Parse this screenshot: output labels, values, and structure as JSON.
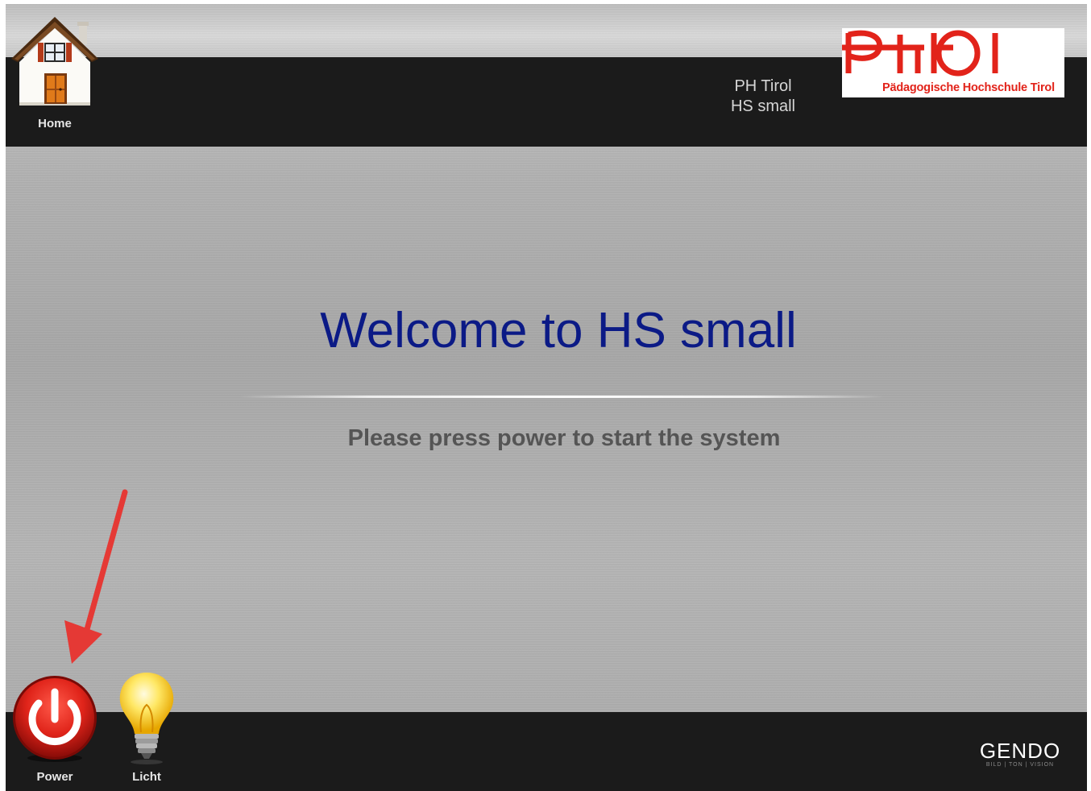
{
  "nav": {
    "home_label": "Home",
    "home_icon": "home-icon"
  },
  "room": {
    "line1": "PH Tirol",
    "line2": "HS small"
  },
  "logo": {
    "subtitle": "Pädagogische Hochschule Tirol",
    "color": "#e2231a"
  },
  "main": {
    "title": "Welcome to HS small",
    "instruction": "Please press power to start the system",
    "title_color": "#0b1a86"
  },
  "footer": {
    "power_label": "Power",
    "licht_label": "Licht",
    "power_icon": "power-icon",
    "licht_icon": "light-bulb-icon",
    "brand": "GENDO",
    "brand_tagline": "BILD | TON | VISION"
  },
  "annotation": {
    "arrow_color": "#e53935"
  }
}
